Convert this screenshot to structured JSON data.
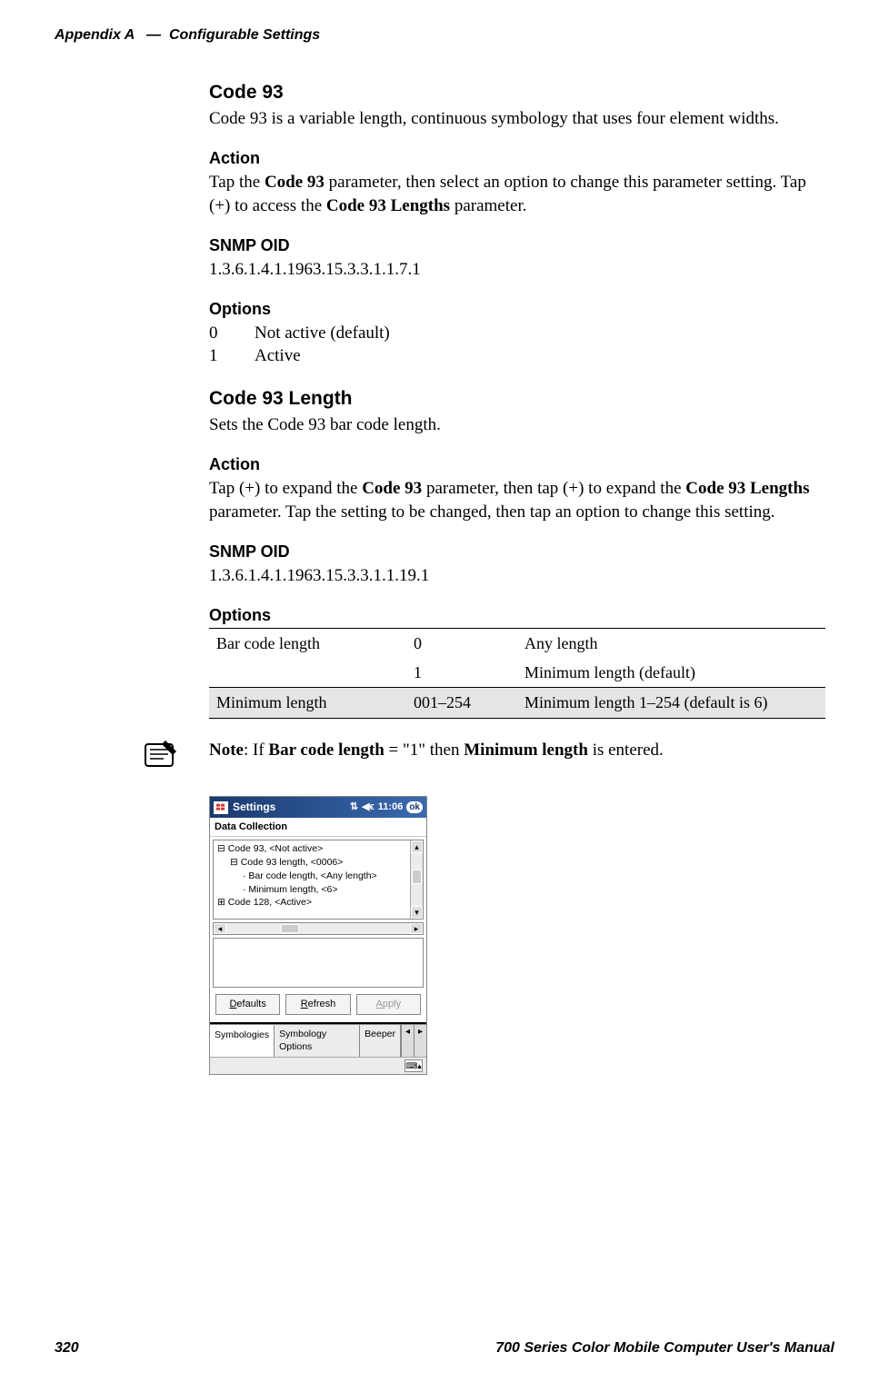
{
  "header": {
    "appendix": "Appendix A",
    "em_dash": "—",
    "title": "Configurable Settings"
  },
  "sections": {
    "code93": {
      "heading": "Code 93",
      "para": "Code 93 is a variable length, continuous symbology that uses four element widths."
    },
    "action1": {
      "heading": "Action",
      "pre": "Tap the ",
      "bold1": "Code 93",
      "mid": " parameter, then select an option to change this parameter setting. Tap (+) to access the ",
      "bold2": "Code 93 Lengths",
      "post": " parameter."
    },
    "snmp1": {
      "heading": "SNMP OID",
      "value": "1.3.6.1.4.1.1963.15.3.3.1.1.7.1"
    },
    "options1": {
      "heading": "Options",
      "rows": [
        {
          "code": "0",
          "desc": "Not active (default)"
        },
        {
          "code": "1",
          "desc": "Active"
        }
      ]
    },
    "code93len": {
      "heading": "Code 93 Length",
      "para": "Sets the Code 93 bar code length."
    },
    "action2": {
      "heading": "Action",
      "pre": "Tap (+) to expand the ",
      "bold1": "Code 93",
      "mid": " parameter, then tap (+) to expand the ",
      "bold2": "Code 93 Lengths",
      "post": " parameter. Tap the setting to be changed, then tap an option to change this setting."
    },
    "snmp2": {
      "heading": "SNMP OID",
      "value": "1.3.6.1.4.1.1963.15.3.3.1.1.19.1"
    },
    "options2": {
      "heading": "Options",
      "rows": [
        {
          "name": "Bar code length",
          "code1": "0",
          "desc1": "Any length",
          "code2": "1",
          "desc2": "Minimum length (default)"
        },
        {
          "name": "Minimum length",
          "code": "001–254",
          "desc": "Minimum length 1–254 (default is 6)"
        }
      ]
    },
    "note": {
      "pre": "Note",
      "mid1": ": If ",
      "bold1": "Bar code length",
      "mid2": " = \"1\" then ",
      "bold2": "Minimum length",
      "post": " is entered."
    }
  },
  "screenshot": {
    "titlebar": {
      "title": "Settings",
      "time": "11:06",
      "ok": "ok"
    },
    "subtitle": "Data Collection",
    "tree": {
      "l1": "Code 93, <Not active>",
      "l2": "Code 93 length, <0006>",
      "l3": "Bar code length, <Any length>",
      "l4": "Minimum length, <6>",
      "l5": "Code 128, <Active>"
    },
    "buttons": {
      "defaults_u": "D",
      "defaults_rest": "efaults",
      "refresh_u": "R",
      "refresh_rest": "efresh",
      "apply_u": "A",
      "apply_rest": "pply"
    },
    "tabs": {
      "t1": "Symbologies",
      "t2": "Symbology Options",
      "t3": "Beeper"
    }
  },
  "footer": {
    "page": "320",
    "manual": "700 Series Color Mobile Computer User's Manual"
  }
}
